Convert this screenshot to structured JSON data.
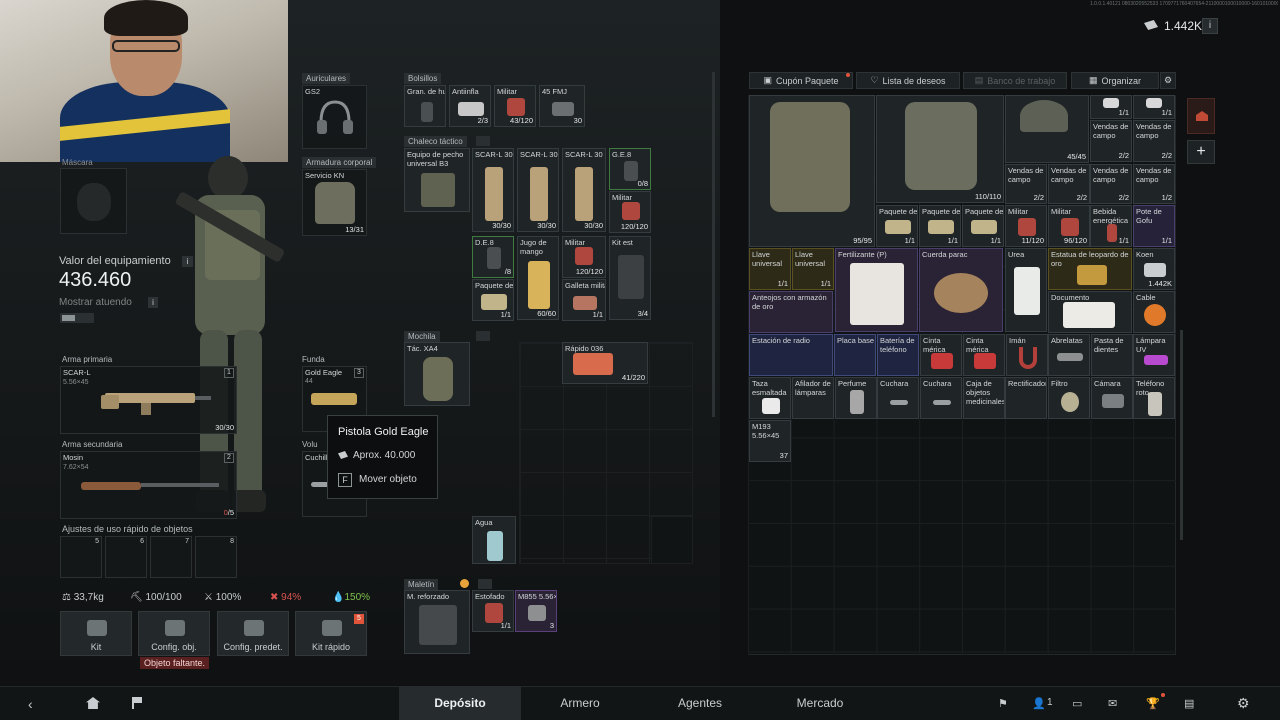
{
  "hud": {
    "build_text": "1.0.0.1.40121 0803020552533 1709771760407654-2110000100010000-1601010000",
    "currency": "1.442K"
  },
  "equipment": {
    "headphones_label": "Auriculares",
    "headphones_item": "GS2",
    "armor_label": "Armadura corporal",
    "armor_item": "Servicio KN",
    "armor_durability": "13/31",
    "mask_label": "Máscara",
    "value_label": "Valor del equipamiento",
    "value": "436.460",
    "show_equipped_label": "Mostrar atuendo",
    "primary_label": "Arma primaria",
    "primary_name": "SCAR-L",
    "primary_caliber": "5.56×45",
    "primary_ammo": "30/30",
    "primary_slot": "1",
    "secondary_label": "Arma secundaria",
    "secondary_name": "Mosin",
    "secondary_caliber": "7.62×54",
    "secondary_ammo_cur": "0",
    "secondary_ammo_max": "/5",
    "secondary_slot": "2",
    "holster_label": "Funda",
    "holster_item": "Gold Eagle",
    "holster_ammo": "44",
    "holster_slot": "3",
    "melee_label": "Volu",
    "melee_item": "Cuchill",
    "quick_label": "Ajustes de uso rápido de objetos",
    "quick_slots": [
      "5",
      "6",
      "7",
      "8"
    ]
  },
  "stats": {
    "weight": "33,7kg",
    "durability": "100/100",
    "energy": "100%",
    "hunger": "94%",
    "hydration": "150%"
  },
  "bottom_buttons": {
    "kit": "Kit",
    "config_obj": "Config. obj.",
    "config_predet": "Config. predet.",
    "kit_rapido": "Kit rápido",
    "kit_rapido_badge": "5",
    "missing": "Objeto faltante."
  },
  "pockets": {
    "label": "Bolsillos",
    "items": [
      {
        "name": "Gran. de humo",
        "count": ""
      },
      {
        "name": "Antiinfla",
        "count": "2/3"
      },
      {
        "name": "Militar",
        "count": "43/120"
      },
      {
        "name": "45 FMJ",
        "count": "30"
      }
    ]
  },
  "vest": {
    "label": "Chaleco táctico",
    "item": "Equipo de pecho universal B3",
    "items": [
      {
        "name": "SCAR-L 30",
        "count": "30/30"
      },
      {
        "name": "SCAR-L 30",
        "count": "30/30"
      },
      {
        "name": "SCAR-L 30",
        "count": "30/30"
      },
      {
        "name": "G.E.8",
        "count": "0/8"
      },
      {
        "name": "Militar",
        "count": "120/120"
      },
      {
        "name": "D.E.8",
        "count": "/8"
      },
      {
        "name": "Jugo de mango",
        "count": "60/60"
      },
      {
        "name": "Militar",
        "count": "120/120"
      },
      {
        "name": "Kit est",
        "count": "3/4"
      },
      {
        "name": "Paquete de",
        "count": "1/1"
      },
      {
        "name": "Galleta militar",
        "count": "1/1"
      }
    ]
  },
  "backpack": {
    "label": "Mochila",
    "item": "Tác. XA4",
    "items": [
      {
        "name": "Rápido 036",
        "count": "41/220"
      },
      {
        "name": "Agua",
        "count": ""
      }
    ]
  },
  "case": {
    "label": "Maletín",
    "item": "M. reforzado",
    "items": [
      {
        "name": "Estofado",
        "count": "1/1"
      },
      {
        "name": "M855 5.56×45",
        "count": "3"
      }
    ]
  },
  "tooltip": {
    "title": "Pistola Gold Eagle",
    "price": "Aprox. 40.000",
    "key": "F",
    "action": "Mover objeto"
  },
  "stash_toolbar": {
    "cupon": "Cupón Paquete",
    "wishlist": "Lista de deseos",
    "workbench": "Banco de trabajo",
    "organize": "Organizar"
  },
  "stash": {
    "big_items": [
      {
        "name": "",
        "count": "95/95"
      },
      {
        "name": "",
        "count": "110/110"
      },
      {
        "name": "",
        "count": "45/45"
      }
    ],
    "rows": [
      [
        {
          "name": "Vendas de campo",
          "count": "1/1"
        },
        {
          "name": "Vendas de campo",
          "count": "1/1"
        }
      ],
      [
        {
          "name": "Vendas de campo",
          "count": "2/2"
        },
        {
          "name": "Vendas de campo",
          "count": "2/2"
        }
      ],
      [
        {
          "name": "Vendas de campo",
          "count": "2/2"
        },
        {
          "name": "Vendas de campo",
          "count": "2/2"
        },
        {
          "name": "Vendas de campo",
          "count": "2/2"
        },
        {
          "name": "Vendas de campo",
          "count": "1/2"
        }
      ],
      [
        {
          "name": "Paquete de",
          "count": "1/1"
        },
        {
          "name": "Paquete de",
          "count": "1/1"
        },
        {
          "name": "Paquete de",
          "count": "1/1"
        },
        {
          "name": "Militar",
          "count": "11/120"
        },
        {
          "name": "Militar",
          "count": "96/120"
        },
        {
          "name": "Bebida energética",
          "count": "1/1"
        },
        {
          "name": "Pote de Gofu",
          "count": "1/1"
        }
      ],
      [
        {
          "name": "Llave universal",
          "count": "1/1"
        },
        {
          "name": "Llave universal",
          "count": "1/1"
        },
        {
          "name": "Fertilizante (P)",
          "count": ""
        },
        {
          "name": "Cuerda parac",
          "count": ""
        },
        {
          "name": "Urea",
          "count": ""
        },
        {
          "name": "Estatua de leopardo de oro",
          "count": ""
        },
        {
          "name": "Koen",
          "count": "1.442K"
        }
      ],
      [
        {
          "name": "Anteojos con armazón de oro",
          "count": ""
        },
        {
          "name": "Documento",
          "count": ""
        },
        {
          "name": "Cable",
          "count": ""
        }
      ],
      [
        {
          "name": "Estación de radio",
          "count": ""
        },
        {
          "name": "Placa base",
          "count": ""
        },
        {
          "name": "Batería de teléfono",
          "count": ""
        },
        {
          "name": "Cinta mérica",
          "count": ""
        },
        {
          "name": "Cinta mérica",
          "count": ""
        },
        {
          "name": "Imán",
          "count": ""
        },
        {
          "name": "Abrelatas",
          "count": ""
        },
        {
          "name": "Pasta de dientes",
          "count": ""
        },
        {
          "name": "Lámpara UV",
          "count": ""
        }
      ],
      [
        {
          "name": "Taza esmaltada",
          "count": ""
        },
        {
          "name": "Afilador de lámparas",
          "count": ""
        },
        {
          "name": "Perfume",
          "count": ""
        },
        {
          "name": "Cuchara",
          "count": ""
        },
        {
          "name": "Cuchara",
          "count": ""
        },
        {
          "name": "Caja de objetos medicinales",
          "count": ""
        },
        {
          "name": "Rectificador",
          "count": ""
        },
        {
          "name": "Filtro",
          "count": ""
        },
        {
          "name": "Cámara",
          "count": ""
        },
        {
          "name": "Teléfono roto",
          "count": ""
        }
      ],
      [
        {
          "name": "M193 5.56×45",
          "count": "37"
        }
      ]
    ]
  },
  "nav": {
    "tabs": [
      "Depósito",
      "Armero",
      "Agentes",
      "Mercado"
    ],
    "active": "Depósito",
    "friends": "1"
  }
}
